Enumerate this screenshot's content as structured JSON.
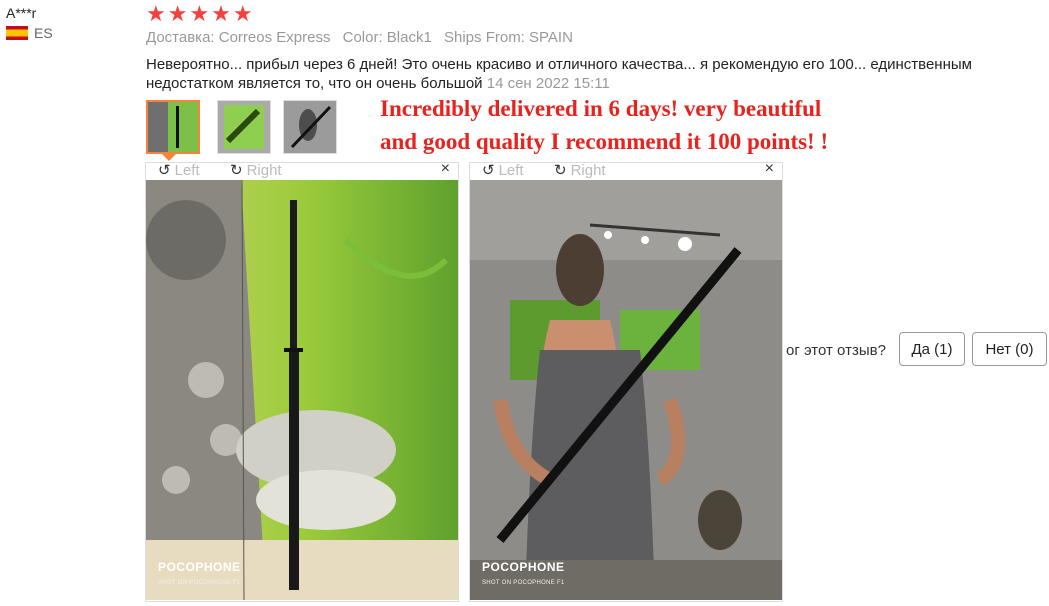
{
  "review": {
    "reviewer": "A***r",
    "country_code": "ES",
    "rating_stars": "★★★★★",
    "rating": 5,
    "meta": {
      "delivery": "Доставка: Correos Express",
      "color": "Color: Black1",
      "ships_from": "Ships From: SPAIN"
    },
    "text": "Невероятно... прибыл через 6 дней! Это очень красиво и отличного качества... я рекомендую его 100... единственным недостатком является то, что он очень большой",
    "date": "14 сен 2022 15:11",
    "overlay_line1": "Incredibly delivered in 6 days!  very beautiful",
    "overlay_line2": "and good quality I recommend it 100 points!  !"
  },
  "viewer": {
    "left_label": "Left",
    "right_label": "Right",
    "close_glyph": "×",
    "photo_brand": "POCOPHONE",
    "photo_sub": "SHOT ON POCOPHONE F1"
  },
  "helpful": {
    "question": "ог этот отзыв?",
    "yes_label": "Да (1)",
    "no_label": "Нет (0)"
  },
  "colors": {
    "star": "#f5413d",
    "overlay_text": "#e8231e",
    "active_thumb": "#f5833b"
  }
}
